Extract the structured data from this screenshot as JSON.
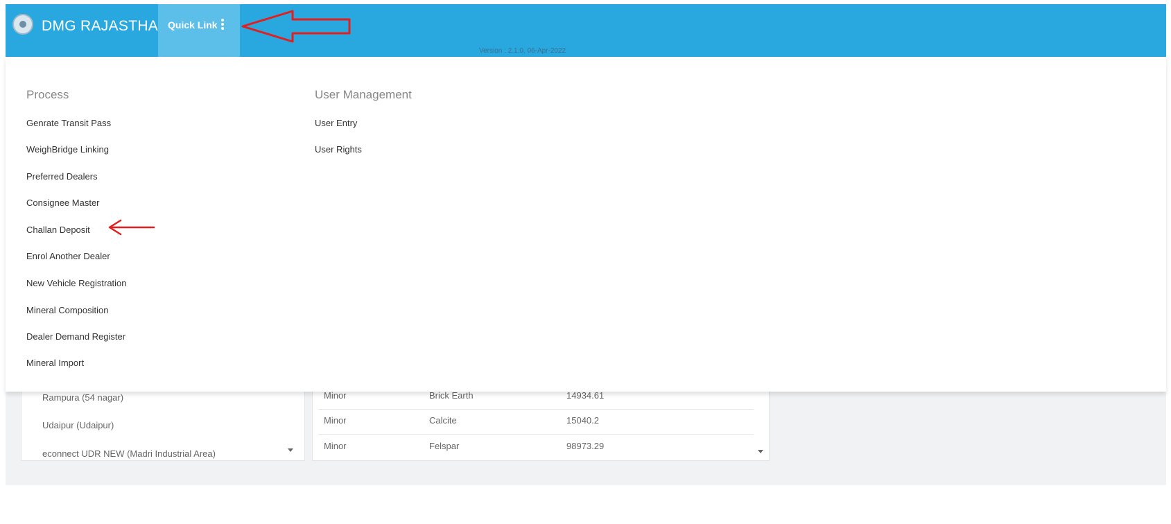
{
  "header": {
    "brand": "DMG RAJASTHAN",
    "quick_link_label": "Quick Link",
    "version_text": "Version : 2.1.0, 06-Apr-2022",
    "colors": {
      "navbar": "#29a8e0",
      "quick_link_bg": "#5bbfea"
    },
    "icons": {
      "logo": "emblem-logo",
      "menu": "vertical-dots-icon"
    }
  },
  "dropdown": {
    "process": {
      "title": "Process",
      "items": [
        "Genrate Transit Pass",
        "WeighBridge Linking",
        "Preferred Dealers",
        "Consignee Master",
        "Challan Deposit",
        "Enrol Another Dealer",
        "New Vehicle Registration",
        "Mineral Composition",
        "Dealer Demand Register",
        "Mineral Import"
      ]
    },
    "user_management": {
      "title": "User Management",
      "items": [
        "User Entry",
        "User Rights"
      ]
    }
  },
  "background": {
    "locations": [
      "Rampura (54 nagar)",
      "Udaipur (Udaipur)",
      "econnect UDR NEW (Madri Industrial Area)"
    ],
    "minerals": [
      {
        "type": "Minor",
        "name": "Brick Earth",
        "qty": "14934.61"
      },
      {
        "type": "Minor",
        "name": "Calcite",
        "qty": "15040.2"
      },
      {
        "type": "Minor",
        "name": "Felspar",
        "qty": "98973.29"
      }
    ]
  },
  "annotation_color": "#e02020"
}
